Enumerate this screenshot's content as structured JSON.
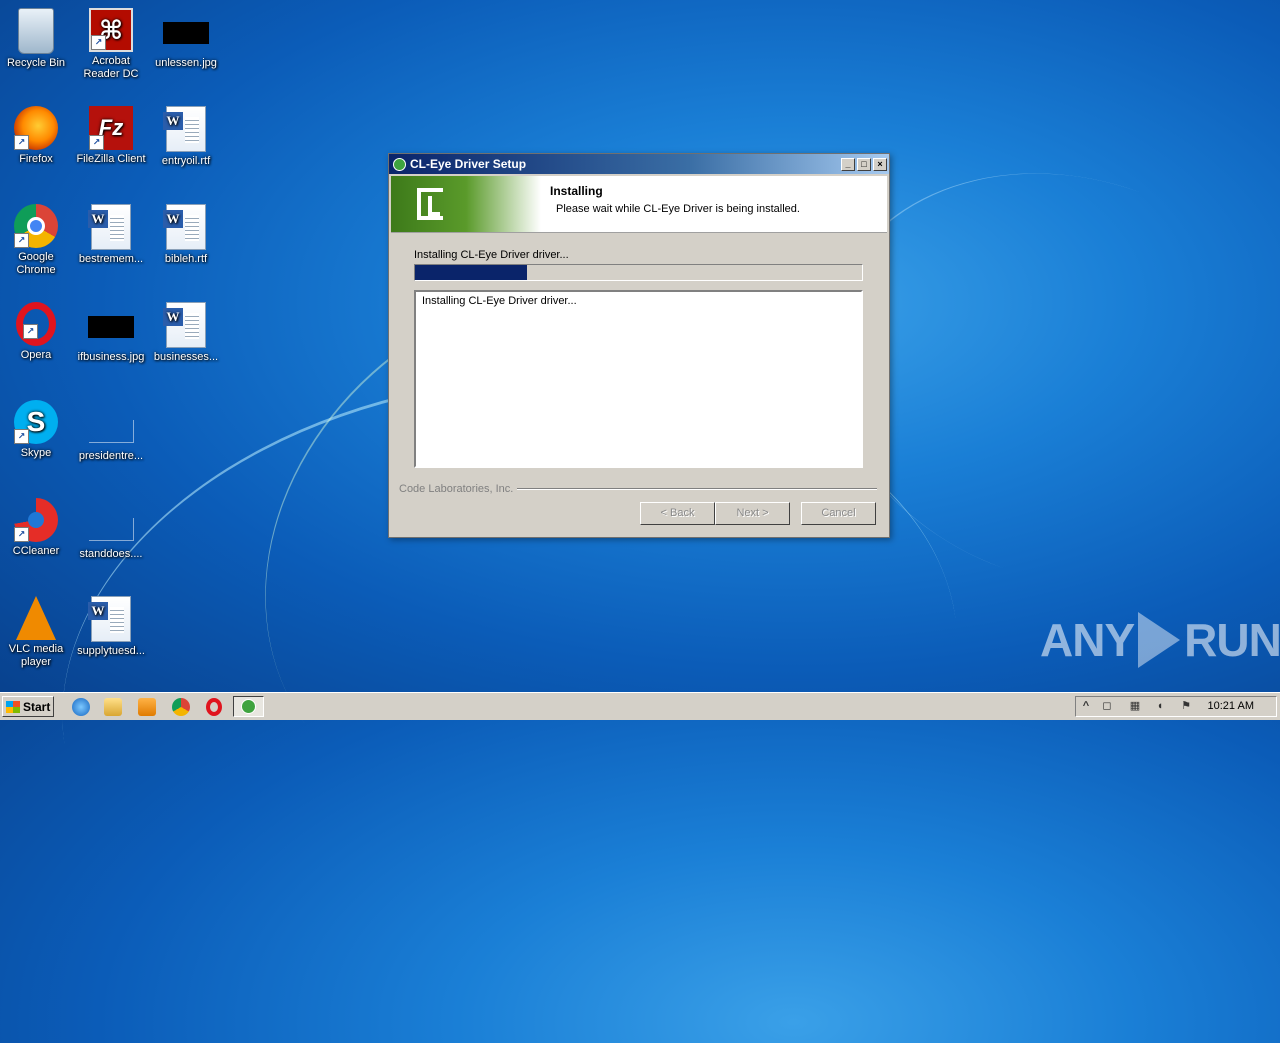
{
  "desktop": {
    "icons": [
      {
        "label": "Recycle Bin"
      },
      {
        "label": "Acrobat Reader DC"
      },
      {
        "label": "unlessen.jpg"
      },
      {
        "label": "Firefox"
      },
      {
        "label": "FileZilla Client"
      },
      {
        "label": "entryoil.rtf"
      },
      {
        "label": "Google Chrome"
      },
      {
        "label": "bestremem..."
      },
      {
        "label": "bibleh.rtf"
      },
      {
        "label": "Opera"
      },
      {
        "label": "ifbusiness.jpg"
      },
      {
        "label": "businesses..."
      },
      {
        "label": "Skype"
      },
      {
        "label": "presidentre..."
      },
      {
        "label": "CCleaner"
      },
      {
        "label": "standdoes...."
      },
      {
        "label": "VLC media player"
      },
      {
        "label": "supplytuesd..."
      }
    ]
  },
  "dialog": {
    "title": "CL-Eye Driver Setup",
    "header_title": "Installing",
    "header_subtitle": "Please wait while CL-Eye Driver is being installed.",
    "status_text": "Installing CL-Eye Driver driver...",
    "progress_fraction": 0.25,
    "log_lines": [
      "Installing CL-Eye Driver driver..."
    ],
    "branding": "Code Laboratories, Inc.",
    "buttons": {
      "back": "< Back",
      "next": "Next >",
      "cancel": "Cancel"
    }
  },
  "taskbar": {
    "start_label": "Start",
    "clock": "10:21 AM"
  },
  "watermark": {
    "left": "ANY",
    "right": "RUN"
  }
}
